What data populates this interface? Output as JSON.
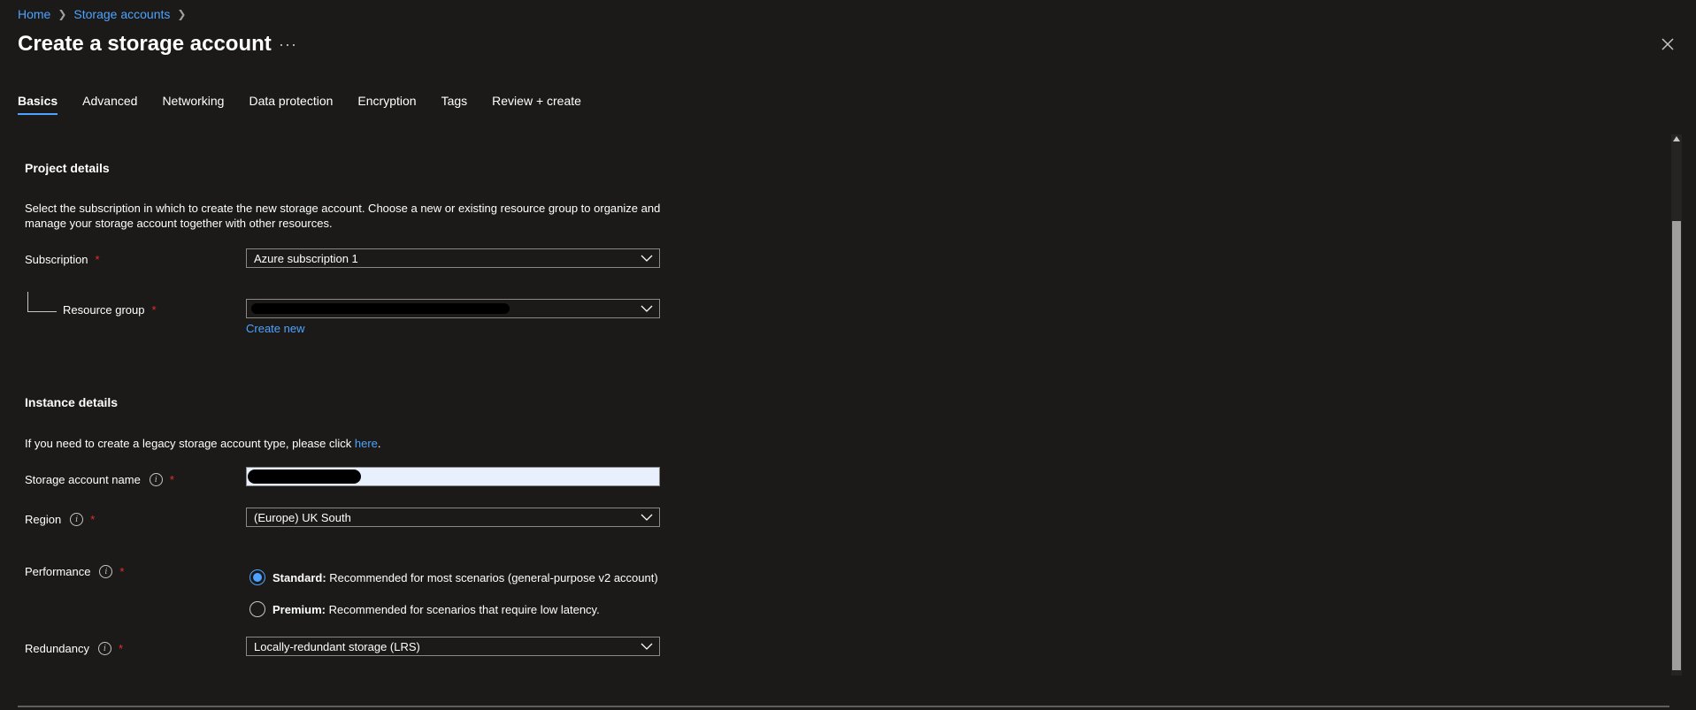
{
  "breadcrumb": {
    "home": "Home",
    "storage_accounts": "Storage accounts"
  },
  "header": {
    "title": "Create a storage account",
    "more": "···"
  },
  "tabs": [
    {
      "label": "Basics",
      "active": true
    },
    {
      "label": "Advanced"
    },
    {
      "label": "Networking"
    },
    {
      "label": "Data protection"
    },
    {
      "label": "Encryption"
    },
    {
      "label": "Tags"
    },
    {
      "label": "Review + create"
    }
  ],
  "project": {
    "title": "Project details",
    "description": "Select the subscription in which to create the new storage account. Choose a new or existing resource group to organize and manage your storage account together with other resources.",
    "subscription_label": "Subscription",
    "subscription_value": "Azure subscription 1",
    "resource_group_label": "Resource group",
    "create_new": "Create new"
  },
  "instance": {
    "title": "Instance details",
    "legacy_text": "If you need to create a legacy storage account type, please click ",
    "legacy_link": "here",
    "legacy_end": ".",
    "name_label": "Storage account name",
    "region_label": "Region",
    "region_value": "(Europe) UK South",
    "performance_label": "Performance",
    "standard_bold": "Standard:",
    "standard_text": " Recommended for most scenarios (general-purpose v2 account)",
    "premium_bold": "Premium:",
    "premium_text": " Recommended for scenarios that require low latency.",
    "redundancy_label": "Redundancy",
    "redundancy_value": "Locally-redundant storage (LRS)"
  },
  "required_mark": "*",
  "colors": {
    "accent": "#4da3ff",
    "required": "#e3302f",
    "background": "#1b1a19"
  }
}
